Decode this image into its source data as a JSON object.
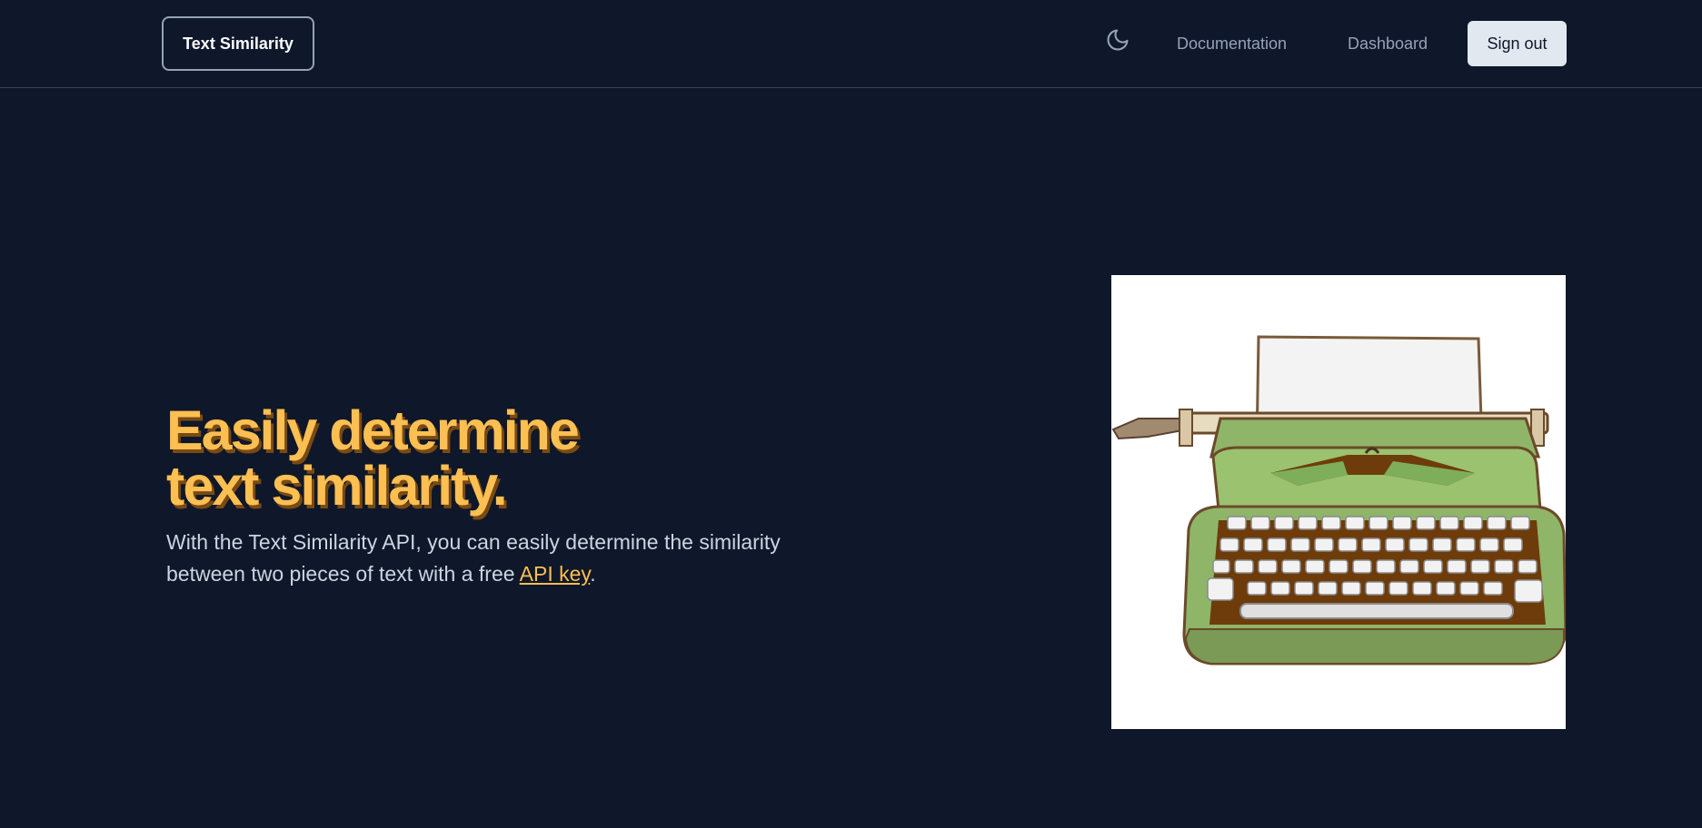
{
  "navbar": {
    "brand_label": "Text Similarity",
    "theme_toggle_icon": "moon-icon",
    "links": [
      {
        "label": "Documentation"
      },
      {
        "label": "Dashboard"
      }
    ],
    "signout_label": "Sign out"
  },
  "hero": {
    "title_line1": "Easily determine",
    "title_line2": "text similarity.",
    "description_before": "With the Text Similarity API, you can easily determine the similarity between two pieces of text with a free ",
    "description_link": "API key",
    "description_after": ".",
    "image_icon": "typewriter-illustration"
  },
  "colors": {
    "background": "#0f172a",
    "accent": "#fbbf52",
    "text": "#cbd5e1",
    "button_bg": "#e2e8f0"
  }
}
